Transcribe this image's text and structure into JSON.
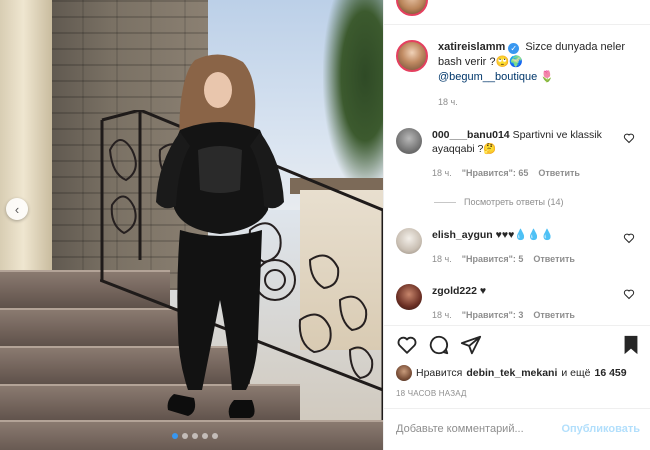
{
  "post": {
    "carousel_prev_icon": "chevron-left-icon",
    "carousel_dots": 5,
    "carousel_active_index": 0
  },
  "caption": {
    "username": "xatireislamm",
    "verified_icon": "verified-badge-icon",
    "text": "Sizce dunyada neler bash verir ?🙄🌍",
    "mention": "@begum__boutique",
    "mention_suffix": " 🌷",
    "time": "18 ч."
  },
  "comments": [
    {
      "username": "000___banu014",
      "text": "Spartivni ve klassik ayaqqabi ?🤔",
      "time": "18 ч.",
      "likes": "\"Нравится\": 65",
      "reply": "Ответить",
      "view_replies": "Посмотреть ответы (14)"
    },
    {
      "username": "elish_aygun",
      "text": "♥♥♥💧💧💧",
      "time": "18 ч.",
      "likes": "\"Нравится\": 5",
      "reply": "Ответить"
    },
    {
      "username": "zgold222",
      "text": "♥",
      "time": "18 ч.",
      "likes": "\"Нравится\": 3",
      "reply": "Ответить"
    }
  ],
  "actions": {
    "like_icon": "heart-icon",
    "comment_icon": "comment-icon",
    "share_icon": "paper-plane-icon",
    "save_icon": "bookmark-icon"
  },
  "likes_line": {
    "prefix": "Нравится",
    "user": "debin_tek_mekani",
    "and_more": "и ещё",
    "count": "16 459"
  },
  "post_time": "18 ЧАСОВ НАЗАД",
  "comment_input": {
    "placeholder": "Добавьте комментарий...",
    "publish": "Опубликовать"
  },
  "colors": {
    "link_blue": "#00376b",
    "accent_blue": "#3897f0",
    "muted": "#8e8e8e",
    "publish_disabled": "#b2dffc"
  }
}
